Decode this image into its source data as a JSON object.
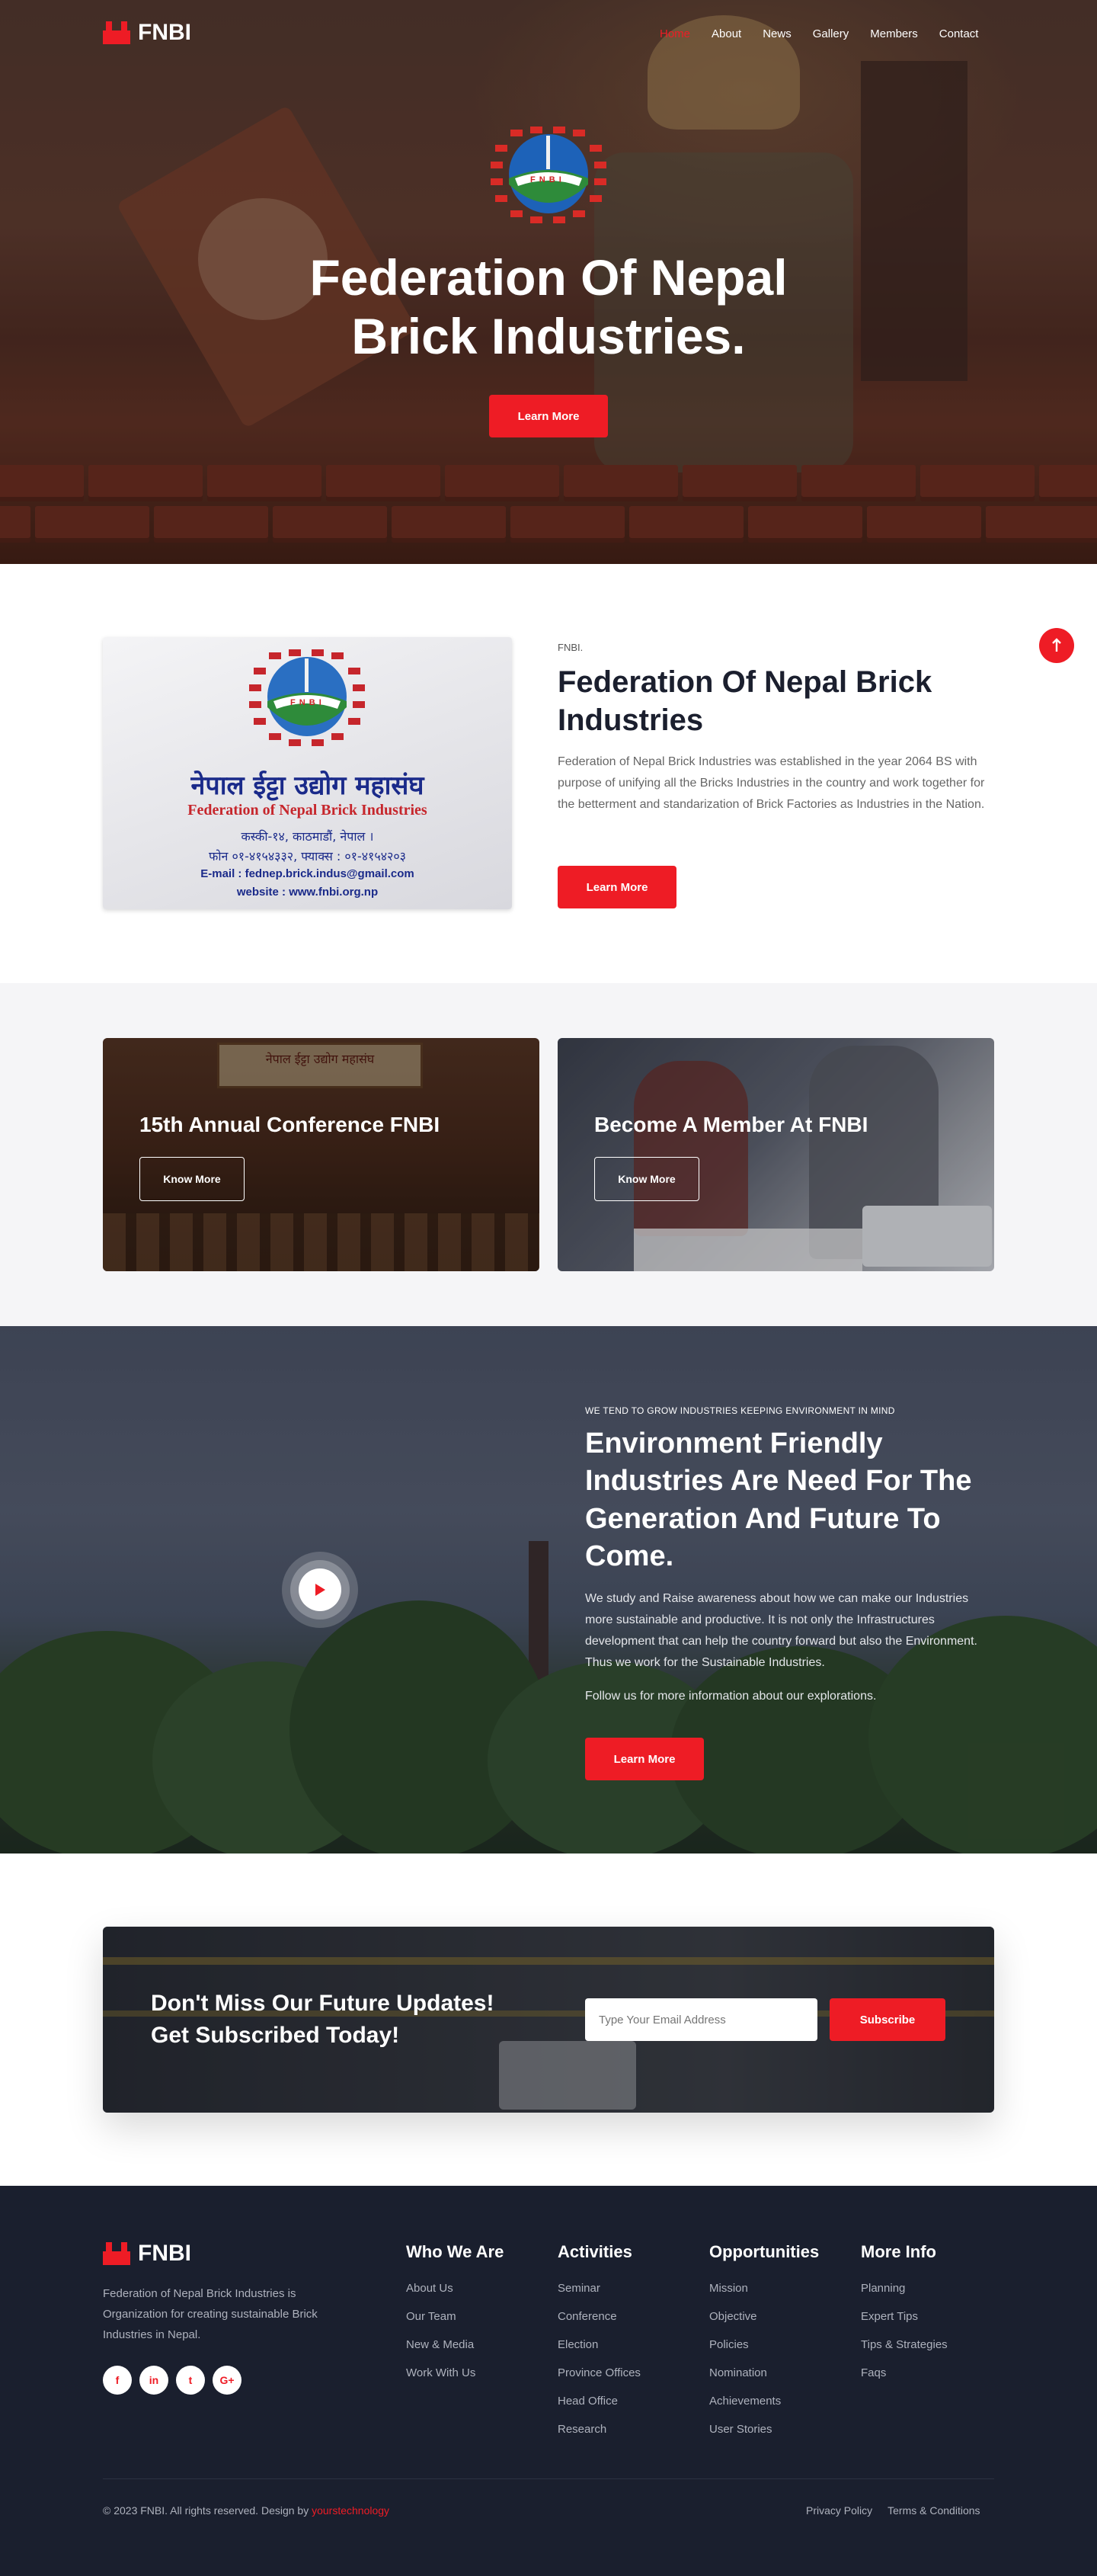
{
  "brand": {
    "name": "FNBI",
    "accent": "#ee1c25",
    "dark": "#1a1f2e"
  },
  "nav": {
    "items": [
      "Home",
      "About",
      "News",
      "Gallery",
      "Members",
      "Contact"
    ],
    "active": "Home"
  },
  "hero": {
    "emblem_text": "F N B I",
    "title": "Federation Of Nepal Brick Industries.",
    "button": "Learn More"
  },
  "about": {
    "card": {
      "emblem_text": "F N B I",
      "nepali_title": "नेपाल ईट्टा उद्योग महासंघ",
      "english_title": "Federation of Nepal Brick Industries",
      "address": "कस्की-१४, काठमाडौं, नेपाल ।",
      "phone": "फोन ०१-४१५४३३२, फ्याक्स : ०१-४१५४२०३",
      "email": "E-mail : fednep.brick.indus@gmail.com",
      "website": "website : www.fnbi.org.np"
    },
    "eyebrow": "FNBI.",
    "title": "Federation Of Nepal Brick Industries",
    "text": "Federation of Nepal Brick Industries was established in the year 2064 BS with purpose of unifying all the Bricks Industries in the country and work together for the betterment and standarization of Brick Factories as Industries in the Nation.",
    "button": "Learn More"
  },
  "promos": [
    {
      "title": "15th Annual Conference FNBI",
      "button": "Know More",
      "banner": "नेपाल ईट्टा उद्योग महासंघ"
    },
    {
      "title": "Become A Member At FNBI",
      "button": "Know More"
    }
  ],
  "env": {
    "eyebrow": "WE TEND TO GROW INDUSTRIES KEEPING ENVIRONMENT IN MIND",
    "title": "Environment Friendly Industries Are Need For The Generation And Future To Come.",
    "text1": "We study and Raise awareness about how we can make our Industries more sustainable and productive. It is not only the Infrastructures development that can help the country forward but also the Environment. Thus we work for the Sustainable Industries.",
    "text2": "Follow us for more information about our explorations.",
    "button": "Learn More",
    "play_icon": "play-icon"
  },
  "subscribe": {
    "title": "Don't Miss Our Future Updates! Get Subscribed Today!",
    "placeholder": "Type Your Email Address",
    "button": "Subscribe"
  },
  "footer": {
    "about": "Federation of Nepal Brick Industries is Organization for creating sustainable Brick Industries in Nepal.",
    "social": [
      "f",
      "in",
      "t",
      "G+"
    ],
    "columns": [
      {
        "title": "Who We Are",
        "links": [
          "About Us",
          "Our Team",
          "New & Media",
          "Work With Us"
        ]
      },
      {
        "title": "Activities",
        "links": [
          "Seminar",
          "Conference",
          "Election",
          "Province Offices",
          "Head Office",
          "Research"
        ]
      },
      {
        "title": "Opportunities",
        "links": [
          "Mission",
          "Objective",
          "Policies",
          "Nomination",
          "Achievements",
          "User Stories"
        ]
      },
      {
        "title": "More Info",
        "links": [
          "Planning",
          "Expert Tips",
          "Tips & Strategies",
          "Faqs"
        ]
      }
    ],
    "copyright": "© 2023 FNBI. All rights reserved. Design by",
    "designer": "yourstechnology",
    "privacy": "Privacy Policy",
    "terms": "Terms & Conditions"
  }
}
